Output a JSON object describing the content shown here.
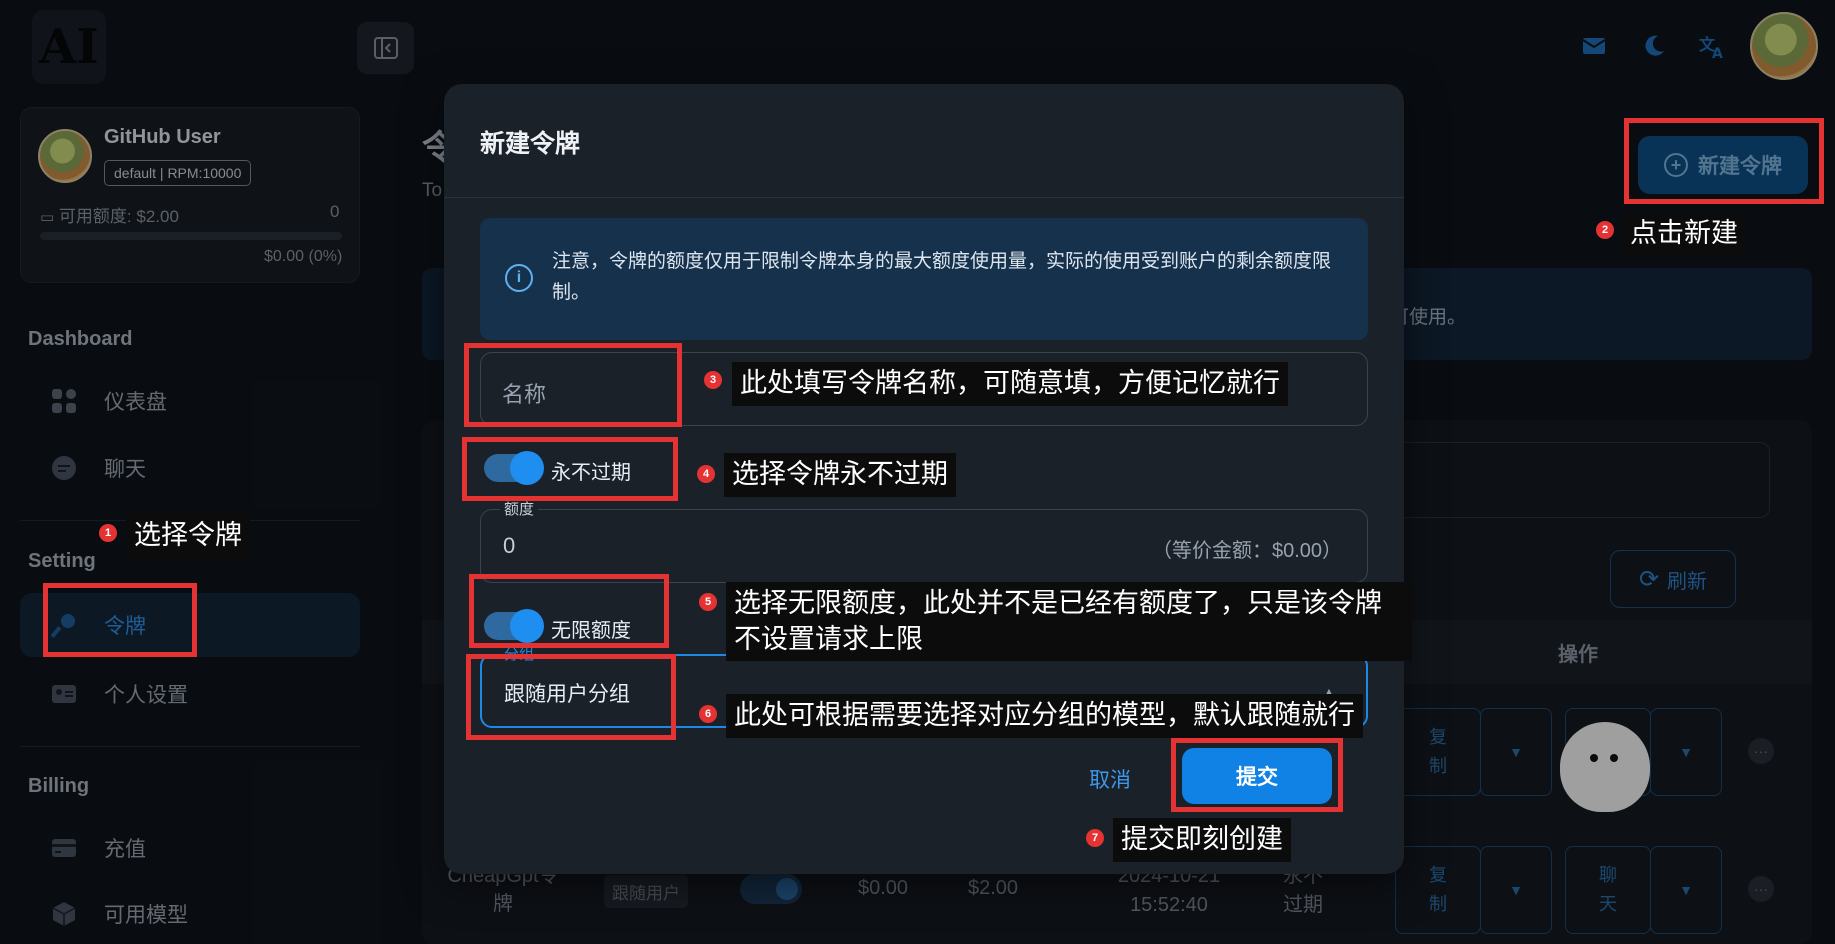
{
  "topbar": {
    "logo_text": "AI",
    "icons": [
      "collapse-sidebar-icon",
      "mail-icon",
      "moon-icon",
      "translate-icon"
    ]
  },
  "sidebar": {
    "user_name": "GitHub User",
    "user_badge": "default | RPM:10000",
    "quota_label": "可用额度: $2.00",
    "quota_value": "0",
    "quota_percent": "$0.00 (0%)",
    "sections": {
      "dashboard": "Dashboard",
      "setting": "Setting",
      "billing": "Billing"
    },
    "items": {
      "dashboard": "仪表盘",
      "chat": "聊天",
      "tokens": "令牌",
      "personal": "个人设置",
      "recharge": "充值",
      "models": "可用模型"
    }
  },
  "page": {
    "title": "令",
    "subtitle": "To",
    "banner_tail": "可使用。",
    "new_token_button": "新建令牌",
    "refresh_button": "刷新",
    "col_actions": "操作",
    "row": {
      "name": "CheapGpt令牌",
      "group": "跟随用户",
      "used": "$0.00",
      "remain": "$2.00",
      "created": "2024-10-21 15:52:40",
      "expire": "永不过期",
      "copy": "复制",
      "chat": "聊天"
    }
  },
  "modal": {
    "title": "新建令牌",
    "notice": "注意，令牌的额度仅用于限制令牌本身的最大额度使用量，实际的使用受到账户的剩余额度限制。",
    "name_placeholder": "名称",
    "never_expire_label": "永不过期",
    "quota_label": "额度",
    "quota_value": "0",
    "quota_equiv": "（等价金额：$0.00）",
    "unlimited_label": "无限额度",
    "group_label": "分组",
    "group_value": "跟随用户分组",
    "cancel_button": "取消",
    "submit_button": "提交"
  },
  "annotations": [
    {
      "num": "1",
      "text": "选择令牌"
    },
    {
      "num": "2",
      "text": "点击新建"
    },
    {
      "num": "3",
      "text": "此处填写令牌名称，可随意填，方便记忆就行"
    },
    {
      "num": "4",
      "text": "选择令牌永不过期"
    },
    {
      "num": "5",
      "text": "选择无限额度，此处并不是已经有额度了，只是该令牌不设置请求上限"
    },
    {
      "num": "6",
      "text": "此处可根据需要选择对应分组的模型，默认跟随就行"
    },
    {
      "num": "7",
      "text": "提交即刻创建"
    }
  ],
  "colors": {
    "accent": "#1082e6",
    "annotation_red": "#e53333",
    "modal_bg": "#1b2129"
  }
}
